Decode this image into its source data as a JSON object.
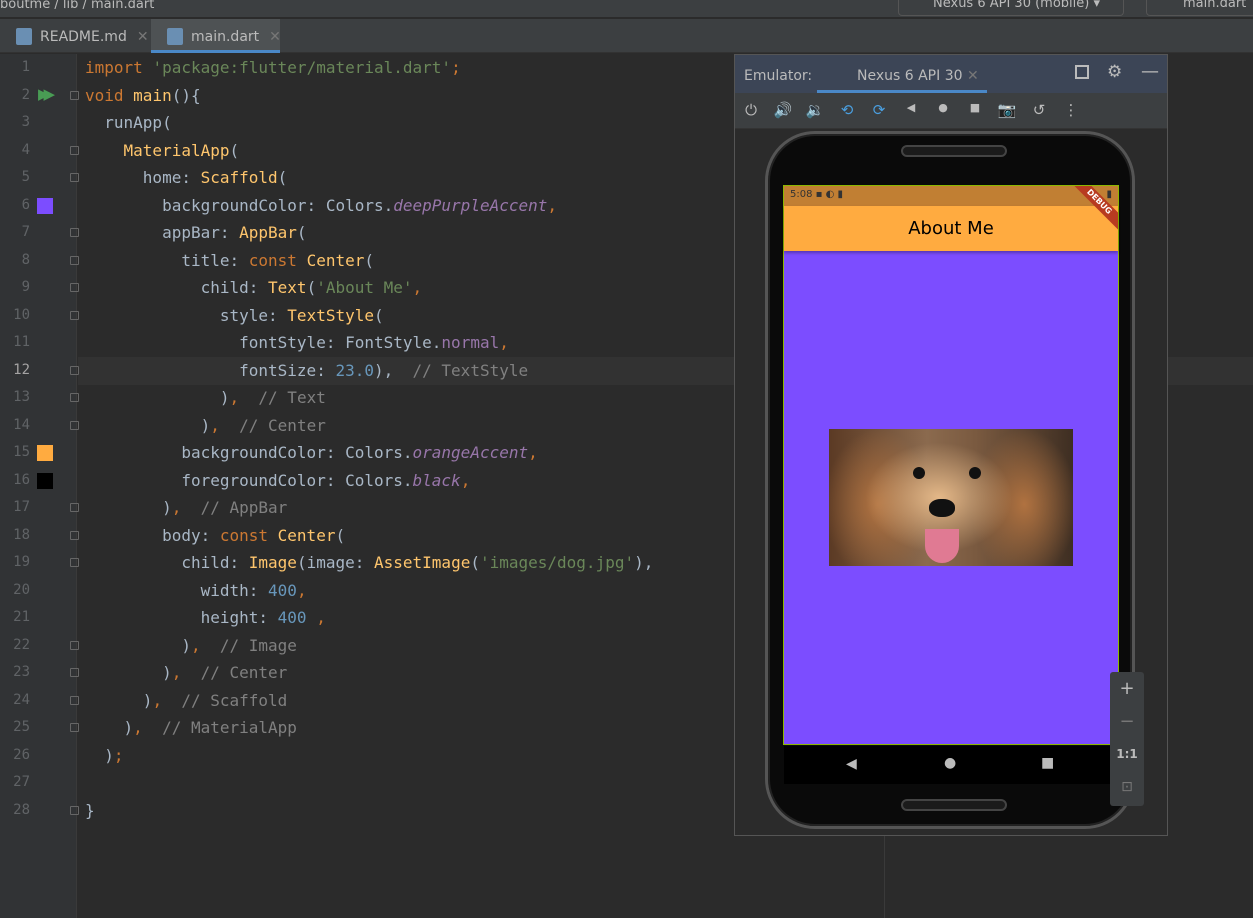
{
  "topbar": {
    "breadcrumb": [
      "boutme",
      "lib",
      "main.dart"
    ],
    "device": "Nexus 6 API 30 (mobile)",
    "run_config": "main.dart"
  },
  "tabs": [
    {
      "label": "README.md",
      "active": false
    },
    {
      "label": "main.dart",
      "active": true
    }
  ],
  "editor": {
    "current_line": 12,
    "lines": [
      [
        [
          "k",
          "import "
        ],
        [
          "s",
          "'package:flutter/material.dart'"
        ],
        [
          "k",
          ";"
        ]
      ],
      [
        [
          "k",
          "void "
        ],
        [
          "c",
          "main"
        ],
        [
          "",
          "(){"
        ]
      ],
      [
        [
          "",
          "  runApp("
        ]
      ],
      [
        [
          "",
          "    "
        ],
        [
          "c",
          "MaterialApp"
        ],
        [
          "",
          "("
        ]
      ],
      [
        [
          "",
          "      home: "
        ],
        [
          "c",
          "Scaffold"
        ],
        [
          "",
          "("
        ]
      ],
      [
        [
          "",
          "        backgroundColor: Colors."
        ],
        [
          "p",
          "deepPurpleAccent"
        ],
        [
          "k",
          ","
        ]
      ],
      [
        [
          "",
          "        appBar: "
        ],
        [
          "c",
          "AppBar"
        ],
        [
          "",
          "("
        ]
      ],
      [
        [
          "",
          "          title: "
        ],
        [
          "k",
          "const "
        ],
        [
          "c",
          "Center"
        ],
        [
          "",
          "("
        ]
      ],
      [
        [
          "",
          "            child: "
        ],
        [
          "c",
          "Text"
        ],
        [
          "",
          "("
        ],
        [
          "s",
          "'About Me'"
        ],
        [
          "k",
          ","
        ]
      ],
      [
        [
          "",
          "              style: "
        ],
        [
          "c",
          "TextStyle"
        ],
        [
          "",
          "("
        ]
      ],
      [
        [
          "",
          "                fontStyle: FontStyle."
        ],
        [
          "f",
          "normal"
        ],
        [
          "k",
          ","
        ]
      ],
      [
        [
          "",
          "                fontSize: "
        ],
        [
          "n",
          "23.0"
        ],
        [
          "",
          "),"
        ],
        [
          "m",
          "  // TextStyle"
        ]
      ],
      [
        [
          "",
          "              )"
        ],
        [
          "k",
          ","
        ],
        [
          "m",
          "  // Text"
        ]
      ],
      [
        [
          "",
          "            )"
        ],
        [
          "k",
          ","
        ],
        [
          "m",
          "  // Center"
        ]
      ],
      [
        [
          "",
          "          backgroundColor: Colors."
        ],
        [
          "p",
          "orangeAccent"
        ],
        [
          "k",
          ","
        ]
      ],
      [
        [
          "",
          "          foregroundColor: Colors."
        ],
        [
          "p",
          "black"
        ],
        [
          "k",
          ","
        ]
      ],
      [
        [
          "",
          "        )"
        ],
        [
          "k",
          ","
        ],
        [
          "m",
          "  // AppBar"
        ]
      ],
      [
        [
          "",
          "        body: "
        ],
        [
          "k",
          "const "
        ],
        [
          "c",
          "Center"
        ],
        [
          "",
          "("
        ]
      ],
      [
        [
          "",
          "          child: "
        ],
        [
          "c",
          "Image"
        ],
        [
          "",
          "(image: "
        ],
        [
          "c",
          "AssetImage"
        ],
        [
          "",
          "("
        ],
        [
          "s",
          "'images/dog.jpg'"
        ],
        [
          "",
          "),"
        ]
      ],
      [
        [
          "",
          "            width: "
        ],
        [
          "n",
          "400"
        ],
        [
          "k",
          ","
        ]
      ],
      [
        [
          "",
          "            height: "
        ],
        [
          "n",
          "400"
        ],
        [
          "k",
          " ,"
        ]
      ],
      [
        [
          "",
          "          )"
        ],
        [
          "k",
          ","
        ],
        [
          "m",
          "  // Image"
        ]
      ],
      [
        [
          "",
          "        )"
        ],
        [
          "k",
          ","
        ],
        [
          "m",
          "  // Center"
        ]
      ],
      [
        [
          "",
          "      )"
        ],
        [
          "k",
          ","
        ],
        [
          "m",
          "  // Scaffold"
        ]
      ],
      [
        [
          "",
          "    )"
        ],
        [
          "k",
          ","
        ],
        [
          "m",
          "  // MaterialApp"
        ]
      ],
      [
        [
          "",
          "  )"
        ],
        [
          "k",
          ";"
        ]
      ],
      [
        [
          "",
          ""
        ]
      ],
      [
        [
          "",
          "}"
        ]
      ]
    ],
    "swatches": {
      "6": "#7c4dff",
      "15": "#ffab40",
      "16": "#000000"
    }
  },
  "emulator": {
    "label": "Emulator:",
    "tab": "Nexus 6 API 30",
    "toolbar_icons": [
      "power-icon",
      "volume-up-icon",
      "volume-down-icon",
      "rotate-left-icon",
      "rotate-right-icon",
      "back-icon",
      "home-icon",
      "overview-icon",
      "screenshot-icon",
      "snapshot-icon",
      "more-icon"
    ],
    "zoom": {
      "plus": "+",
      "minus": "−",
      "one_to_one": "1:1"
    }
  },
  "app": {
    "status_time": "5:08",
    "title": "About Me",
    "debug_banner": "DEBUG",
    "background_color": "#7c4dff",
    "appbar_color": "#ffab40",
    "image": "images/dog.jpg"
  }
}
